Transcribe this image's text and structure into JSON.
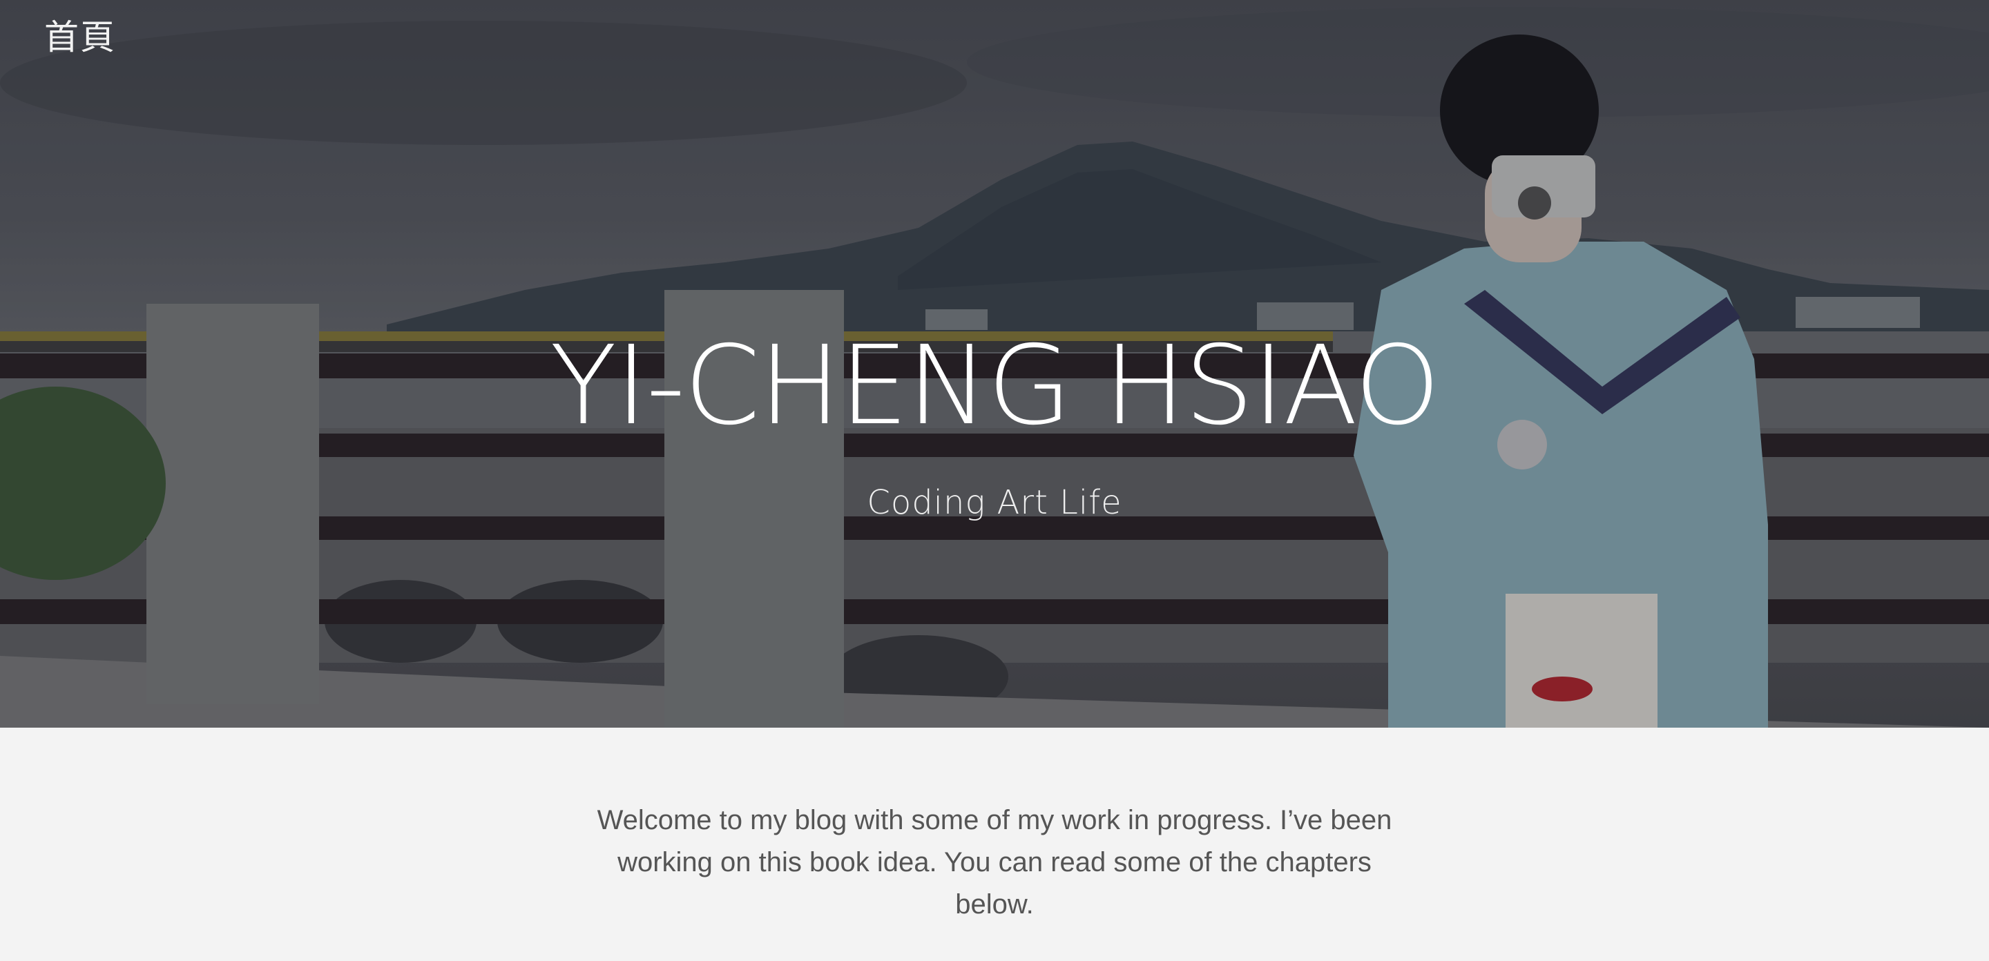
{
  "nav": {
    "home_label": "首頁"
  },
  "hero": {
    "title": "YI-CHENG HSIAO",
    "subtitle": "Coding Art Life",
    "image": "hero-photo"
  },
  "intro": {
    "text": "Welcome to my blog with some of my work in progress. I’ve been working on this book idea. You can read some of the chapters below."
  },
  "colors": {
    "page_background": "#f3f3f3",
    "body_text": "#555555",
    "hero_text": "#ffffff"
  }
}
